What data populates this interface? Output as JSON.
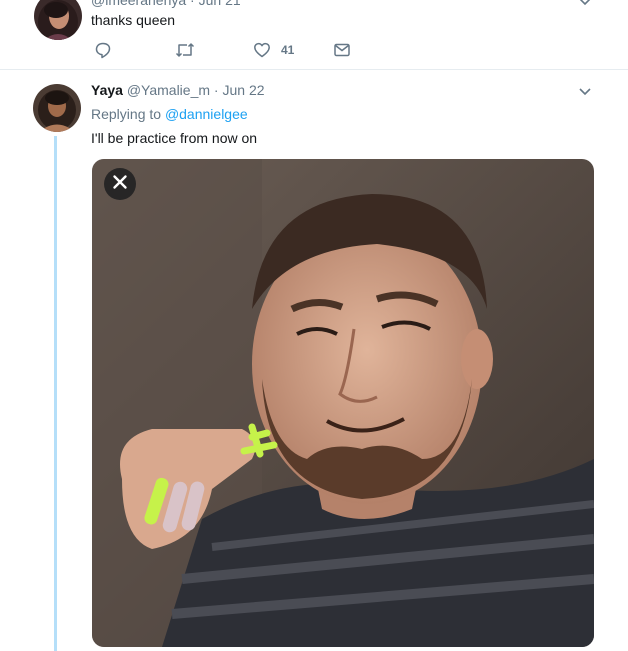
{
  "top_tweet": {
    "handle": "@imeeranenya",
    "date": "Jun 21",
    "text": "thanks queen",
    "like_count": "41",
    "icons": [
      "reply-icon",
      "retweet-icon",
      "heart-icon",
      "direct-message-icon",
      "chevron-down-icon"
    ]
  },
  "main_tweet": {
    "display_name": "Yaya",
    "handle": "@Yamalie_m",
    "separator": "·",
    "date": "Jun 22",
    "replying_prefix": "Replying to",
    "replying_mention": "@dannielgee",
    "text": "I'll be practice from now on",
    "icons": [
      "chevron-down-icon",
      "close-icon"
    ]
  },
  "colors": {
    "accent": "#1da1f2",
    "thread_line": "#b5dff9",
    "secondary_text": "#657786",
    "nail_color": "#c6f24a"
  }
}
